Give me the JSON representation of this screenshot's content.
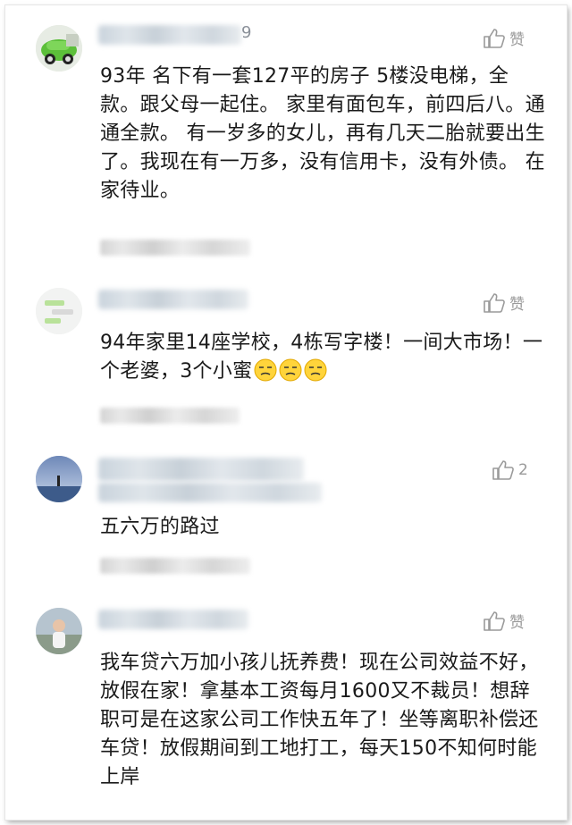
{
  "comments": [
    {
      "name_suffix": "9",
      "like_label": "赞",
      "text": "93年 名下有一套127平的房子 5楼没电梯，全款。跟父母一起住。 家里有面包车，前四后八。通通全款。 有一岁多的女儿，再有几天二胎就要出生了。我现在有一万多，没有信用卡，没有外债。 在家待业。"
    },
    {
      "like_label": "赞",
      "text": "94年家里14座学校，4栋写字楼！一间大市场！一个老婆，3个小蜜",
      "emojis": [
        "smirk-face-icon",
        "smirk-face-icon",
        "smirk-face-icon"
      ]
    },
    {
      "like_label": "2",
      "text": "五六万的路过"
    },
    {
      "like_label": "赞",
      "text": "我车贷六万加小孩儿抚养费！现在公司效益不好，放假在家！拿基本工资每月1600又不裁员！想辞职可是在这家公司工作快五年了！坐等离职补偿还车贷！放假期间到工地打工，每天150不知何时能上岸"
    }
  ],
  "colors": {
    "text": "#1a1a1a",
    "muted": "#9a9a9a",
    "name_blur": "#c9d3dc"
  }
}
